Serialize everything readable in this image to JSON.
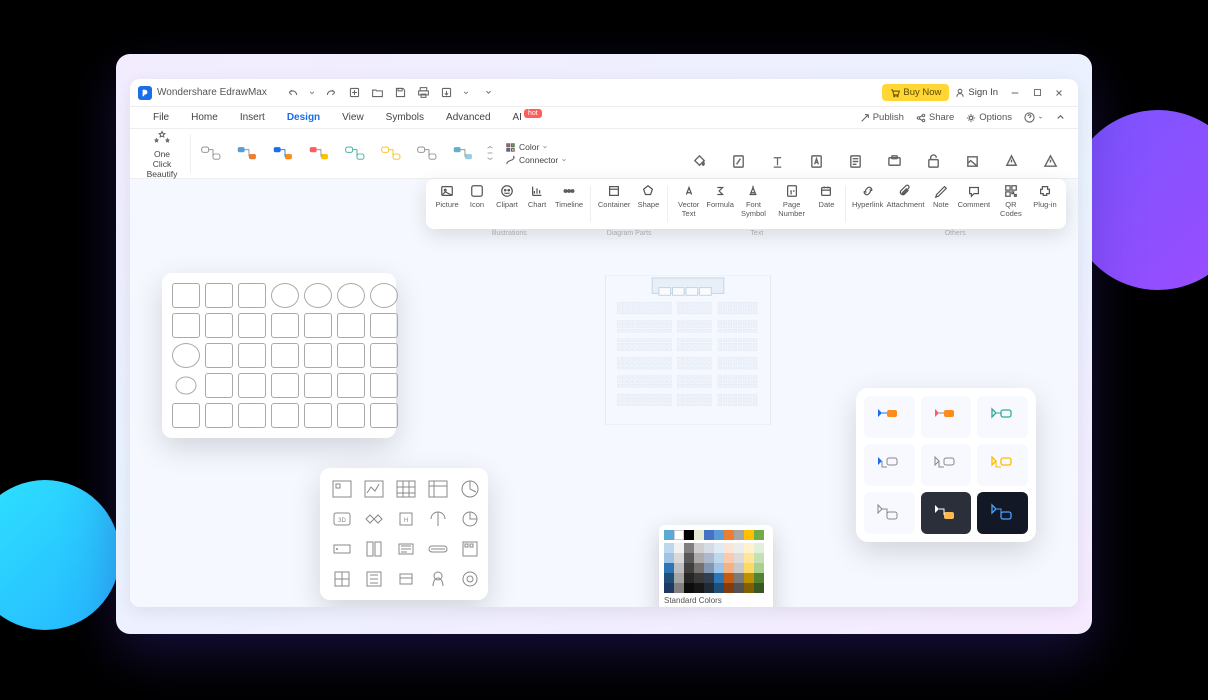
{
  "app": {
    "title": "Wondershare EdrawMax"
  },
  "titlebar": {
    "buy_now": "Buy Now",
    "sign_in": "Sign In"
  },
  "menus": {
    "items": [
      "File",
      "Home",
      "Insert",
      "Design",
      "View",
      "Symbols",
      "Advanced",
      "AI"
    ],
    "hot_label": "hot",
    "publish": "Publish",
    "share": "Share",
    "options": "Options"
  },
  "ribbon": {
    "beautify_line1": "One Click",
    "beautify_line2": "Beautify",
    "color_label": "Color",
    "connector_label": "Connector"
  },
  "toolbar": {
    "items": [
      "Picture",
      "Icon",
      "Clipart",
      "Chart",
      "Timeline",
      "Container",
      "Shape",
      "Vector Text",
      "Formula",
      "Font Symbol",
      "Page Number",
      "Date",
      "Hyperlink",
      "Attachment",
      "Note",
      "Comment",
      "QR Codes",
      "Plug-in"
    ],
    "sections": [
      "Illustrations",
      "Diagram Parts",
      "Text",
      "Others"
    ]
  },
  "color_popup": {
    "standard_label": "Standard Colors",
    "row1": [
      "#5aa9d6",
      "#ffffff",
      "#000000",
      "#e8ead0",
      "#4472c4",
      "#5b9bd5",
      "#ed7d31",
      "#a5a5a5",
      "#ffc000",
      "#70ad47"
    ],
    "grid": [
      [
        "#bdd7ee",
        "#f2f2f2",
        "#7f7f7f",
        "#d0cece",
        "#d6dce5",
        "#deebf7",
        "#fbe5d6",
        "#ededed",
        "#fff2cc",
        "#e2efda"
      ],
      [
        "#9dc3e6",
        "#d9d9d9",
        "#595959",
        "#aeabab",
        "#adb9ca",
        "#bdd7ee",
        "#f8cbad",
        "#dbdbdb",
        "#ffe699",
        "#c5e0b4"
      ],
      [
        "#2e75b6",
        "#bfbfbf",
        "#404040",
        "#757171",
        "#8497b0",
        "#9dc3e6",
        "#f4b183",
        "#c9c9c9",
        "#ffd966",
        "#a9d18e"
      ],
      [
        "#1f4e79",
        "#a6a6a6",
        "#262626",
        "#3b3838",
        "#333f50",
        "#2e75b6",
        "#c55a11",
        "#7b7b7b",
        "#bf9000",
        "#548235"
      ],
      [
        "#1e3864",
        "#808080",
        "#0d0d0d",
        "#171717",
        "#222a35",
        "#1f4e79",
        "#843c0c",
        "#525252",
        "#806000",
        "#385723"
      ]
    ],
    "standard": [
      "#c00000",
      "#ff0000",
      "#ffc000",
      "#ffff00",
      "#92d050",
      "#00b050",
      "#00b0f0",
      "#0070c0",
      "#002060",
      "#7030a0"
    ]
  }
}
